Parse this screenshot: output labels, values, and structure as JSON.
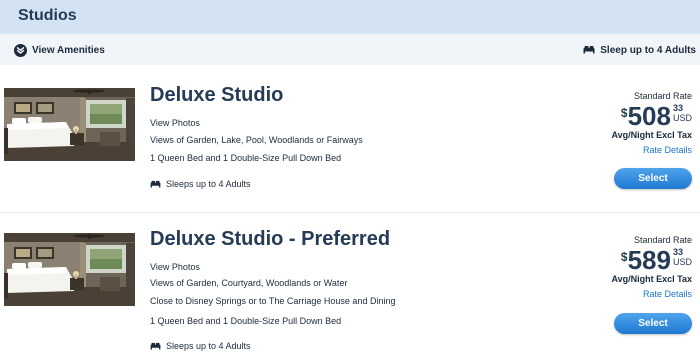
{
  "header": {
    "title": "Studios"
  },
  "amenities": {
    "view_label": "View Amenities",
    "view_icon": "chevron-down-circle-icon",
    "occupancy_label": "Sleep up to 4 Adults",
    "occupancy_icon": "bed-icon"
  },
  "rooms": [
    {
      "title": "Deluxe Studio",
      "view_photos": "View Photos",
      "lines": [
        "Views of Garden, Lake, Pool, Woodlands or Fairways",
        "1 Queen Bed and 1 Double-Size Pull Down Bed"
      ],
      "sleeps": "Sleeps up to 4 Adults",
      "rate_type": "Standard Rate",
      "currency_symbol": "$",
      "price_dollars": "508",
      "price_cents": "33",
      "currency": "USD",
      "price_note": "Avg/Night Excl Tax",
      "rate_details": "Rate Details",
      "select_label": "Select"
    },
    {
      "title": "Deluxe Studio - Preferred",
      "view_photos": "View Photos",
      "lines": [
        "Views of Garden, Courtyard, Woodlands or Water",
        "Close to Disney Springs or to The Carriage House and Dining",
        "1 Queen Bed and 1 Double-Size Pull Down Bed"
      ],
      "sleeps": "Sleeps up to 4 Adults",
      "rate_type": "Standard Rate",
      "currency_symbol": "$",
      "price_dollars": "589",
      "price_cents": "33",
      "currency": "USD",
      "price_note": "Avg/Night Excl Tax",
      "rate_details": "Rate Details",
      "select_label": "Select"
    }
  ],
  "colors": {
    "header_bg": "#d3e3f3",
    "amenities_bg": "#f1f4f8",
    "title_text": "#253b56",
    "link": "#1a73c9",
    "button": "#2f89de"
  }
}
